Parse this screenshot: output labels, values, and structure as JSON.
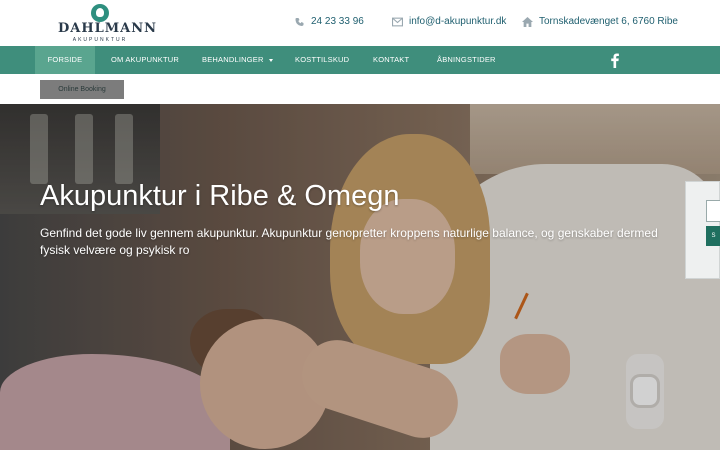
{
  "logo": {
    "name": "DAHLMANN",
    "tagline": "AKUPUNKTUR"
  },
  "contact": {
    "phone": "24 23 33 96",
    "email": "info@d-akupunktur.dk",
    "address": "Tornskadevænget 6, 6760 Ribe",
    "phone_icon": "phone-icon",
    "email_icon": "envelope-icon",
    "address_icon": "home-icon"
  },
  "nav": {
    "items": [
      {
        "label": "FORSIDE",
        "active": true
      },
      {
        "label": "OM AKUPUNKTUR"
      },
      {
        "label": "BEHANDLINGER",
        "has_dropdown": true
      },
      {
        "label": "KOSTTILSKUD"
      },
      {
        "label": "KONTAKT"
      },
      {
        "label": "ÅBNINGSTIDER"
      }
    ],
    "social_icon": "facebook-icon"
  },
  "booking": {
    "label": "Online Booking"
  },
  "hero": {
    "title": "Akupunktur i Ribe & Omegn",
    "text": "Genfind det gode liv gennem akupunktur. Akupunktur genopretter kroppens naturlige balance, og genskaber dermed fysisk velvære og psykisk ro"
  },
  "side_widget": {
    "button_label": "S"
  },
  "colors": {
    "nav_bg": "#3f8e7c",
    "nav_active": "#5aa58f",
    "accent_text": "#1f5f6f",
    "booking_btn": "#7c7c7c"
  }
}
